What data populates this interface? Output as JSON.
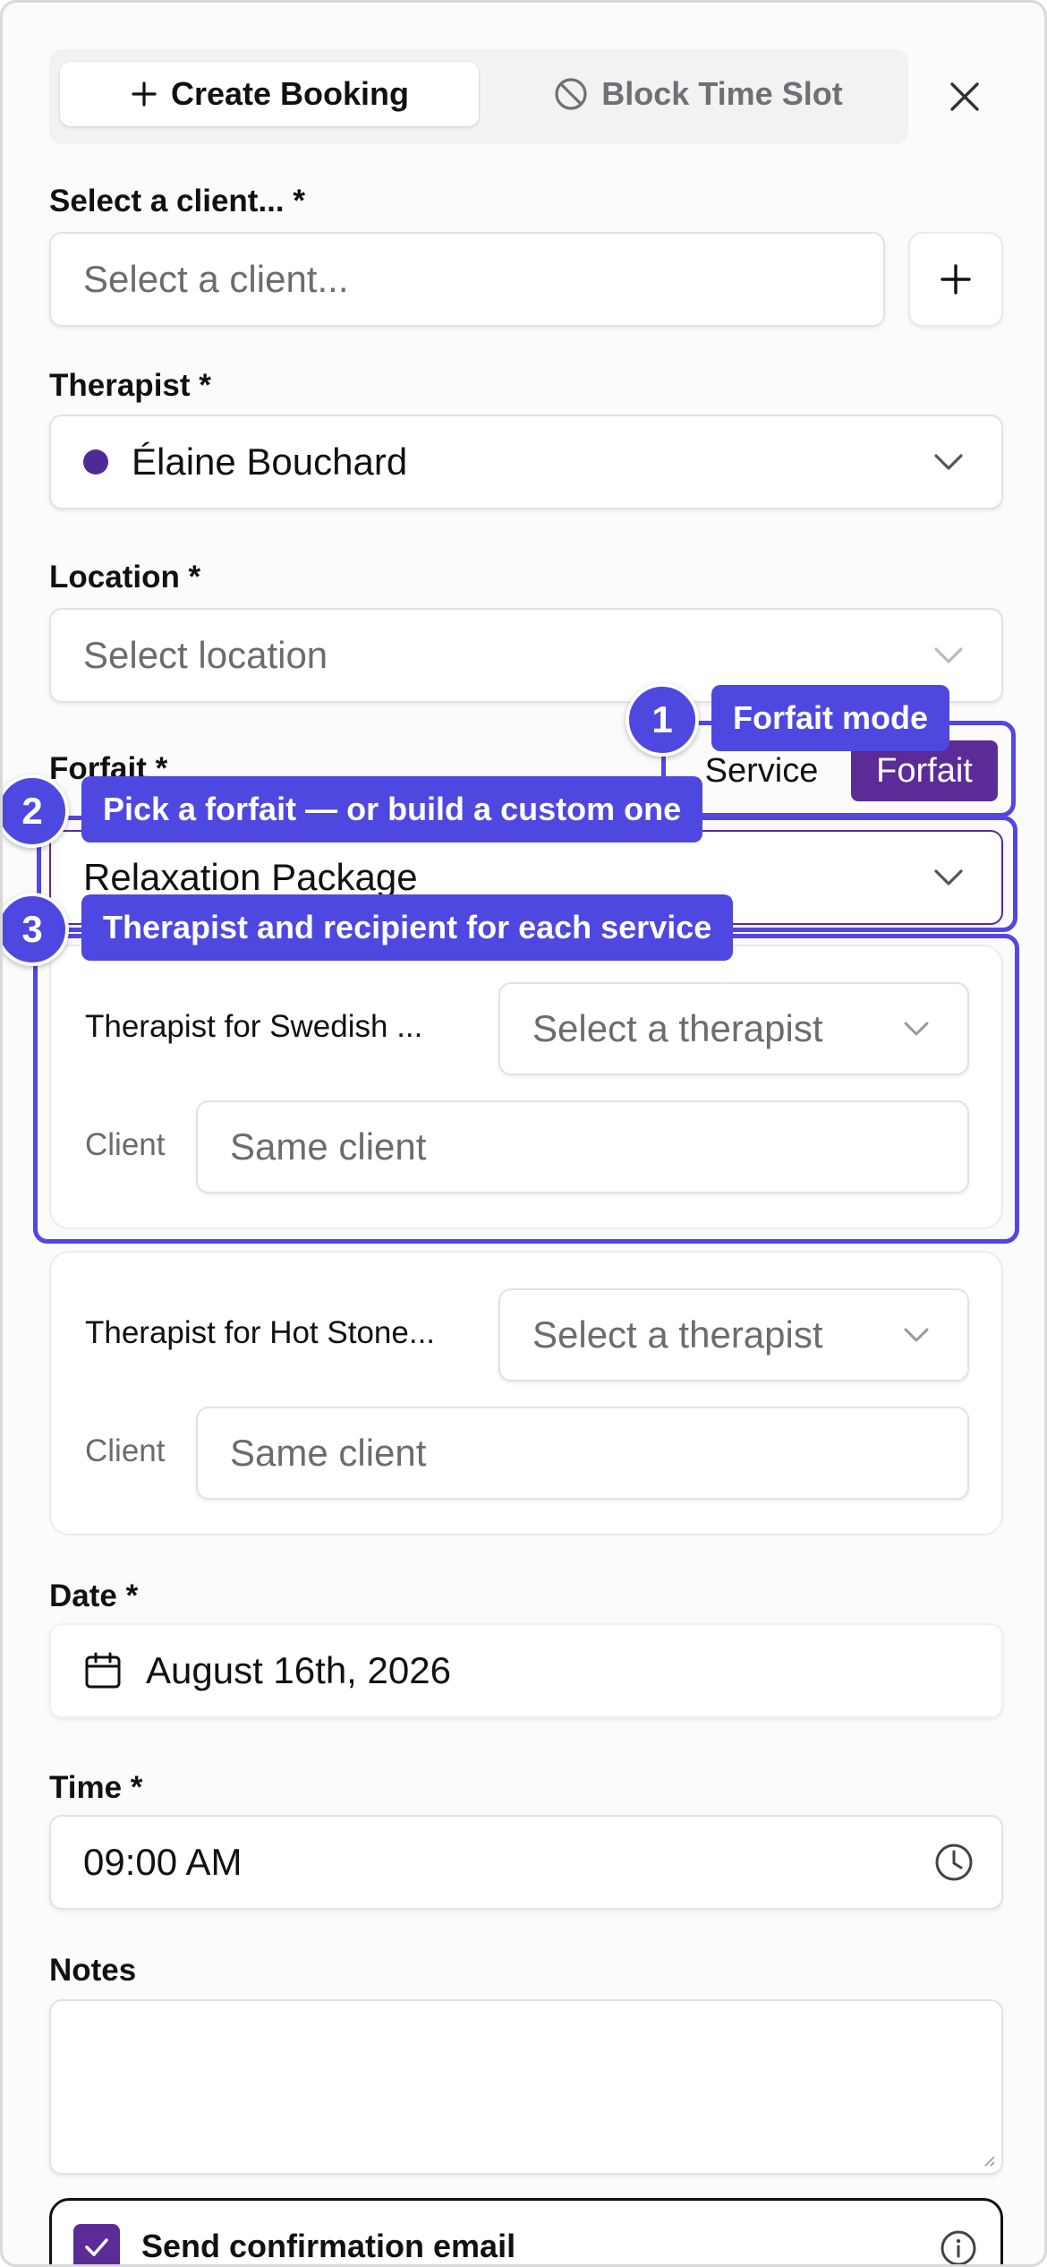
{
  "tabs": {
    "create_label": "Create Booking",
    "block_label": "Block Time Slot"
  },
  "client": {
    "label": "Select a client... *",
    "placeholder": "Select a client..."
  },
  "therapist": {
    "label": "Therapist *",
    "value": "Élaine Bouchard",
    "color": "#4f2a97"
  },
  "location": {
    "label": "Location *",
    "placeholder": "Select location"
  },
  "forfait": {
    "label": "Forfait *",
    "mode_service": "Service",
    "mode_forfait": "Forfait",
    "value": "Relaxation Package"
  },
  "services": [
    {
      "therapist_label": "Therapist for Swedish ...",
      "therapist_placeholder": "Select a therapist",
      "client_label": "Client",
      "client_placeholder": "Same client"
    },
    {
      "therapist_label": "Therapist for Hot Stone...",
      "therapist_placeholder": "Select a therapist",
      "client_label": "Client",
      "client_placeholder": "Same client"
    }
  ],
  "date": {
    "label": "Date *",
    "value": "August 16th, 2026"
  },
  "time": {
    "label": "Time *",
    "value": "09:00 AM"
  },
  "notes": {
    "label": "Notes"
  },
  "email": {
    "label": "Send confirmation email",
    "checked": true
  },
  "callouts": [
    {
      "number": "1",
      "text": "Forfait mode"
    },
    {
      "number": "2",
      "text": "Pick a forfait — or build a custom one"
    },
    {
      "number": "3",
      "text": "Therapist and recipient for each service"
    }
  ],
  "colors": {
    "accent": "#5b2b98",
    "highlight": "#4e48e0"
  }
}
